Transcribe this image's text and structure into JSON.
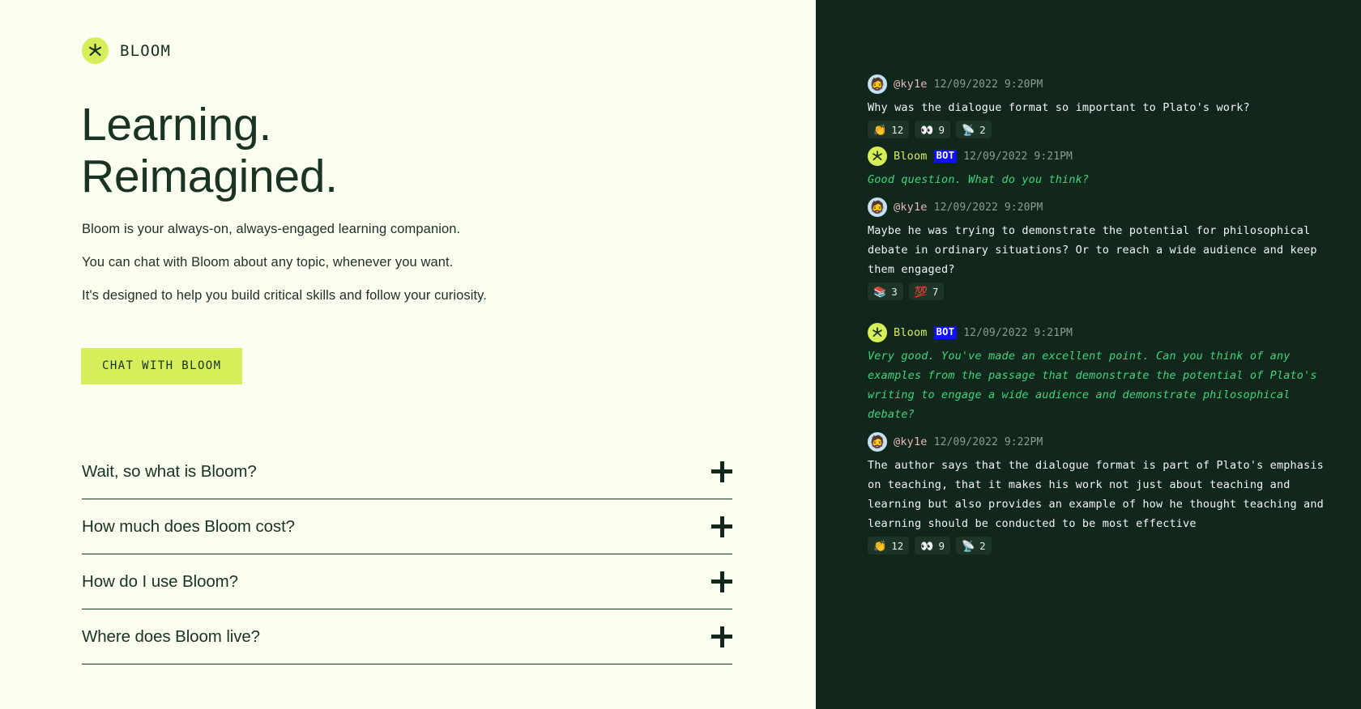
{
  "brand": {
    "name": "BLOOM",
    "logo_icon": "bloom-asterisk-icon",
    "accent_color": "#D7EE5B",
    "dark_color": "#11271C",
    "cream_color": "#FBFFF0"
  },
  "hero": {
    "headline": "Learning.\nReimagined.",
    "paragraphs": [
      "Bloom is your always-on, always-engaged learning companion.",
      "You can chat with Bloom about any topic, whenever you want.",
      "It's designed to help you build critical skills and follow your curiosity."
    ],
    "cta_label": "CHAT WITH BLOOM"
  },
  "faq": {
    "items": [
      {
        "question": "Wait, so what is Bloom?",
        "toggle_icon": "plus-icon"
      },
      {
        "question": "How much does Bloom cost?",
        "toggle_icon": "plus-icon"
      },
      {
        "question": "How do I use Bloom?",
        "toggle_icon": "plus-icon"
      },
      {
        "question": "Where does Bloom live?",
        "toggle_icon": "plus-icon"
      }
    ]
  },
  "chat": {
    "messages": [
      {
        "author": "@ky1e",
        "author_type": "user",
        "avatar_emoji": "🧔",
        "is_bot": false,
        "timestamp": "12/09/2022 9:20PM",
        "text": "Why was the dialogue format so important to Plato's work?",
        "reactions": [
          {
            "emoji": "👏",
            "count": "12"
          },
          {
            "emoji": "👀",
            "count": "9"
          },
          {
            "emoji": "📡",
            "count": "2"
          }
        ]
      },
      {
        "author": "Bloom",
        "author_type": "bot",
        "avatar_emoji": "",
        "is_bot": true,
        "bot_badge": "BOT",
        "timestamp": "12/09/2022 9:21PM",
        "text": "Good question. What do you think?",
        "reactions": []
      },
      {
        "author": "@ky1e",
        "author_type": "user",
        "avatar_emoji": "🧔",
        "is_bot": false,
        "timestamp": "12/09/2022 9:20PM",
        "text": "Maybe he was trying to demonstrate the potential for philosophical debate in ordinary situations? Or to reach a wide audience and keep them engaged?",
        "reactions": [
          {
            "emoji": "📚",
            "count": "3"
          },
          {
            "emoji": "💯",
            "count": "7"
          }
        ]
      },
      {
        "author": "Bloom",
        "author_type": "bot",
        "avatar_emoji": "",
        "is_bot": true,
        "bot_badge": "BOT",
        "timestamp": "12/09/2022 9:21PM",
        "text": "Very good. You've made an excellent point. Can you think of any examples from the passage that demonstrate the potential of Plato's writing to engage a wide audience and demonstrate philosophical debate?",
        "reactions": []
      },
      {
        "author": "@ky1e",
        "author_type": "user",
        "avatar_emoji": "🧔",
        "is_bot": false,
        "timestamp": "12/09/2022 9:22PM",
        "text": "The author says that the dialogue format is part of Plato's emphasis on teaching, that it makes his work not just about teaching and learning but also provides an example of how he thought teaching and learning should be conducted to be most effective",
        "reactions": [
          {
            "emoji": "👏",
            "count": "12"
          },
          {
            "emoji": "👀",
            "count": "9"
          },
          {
            "emoji": "📡",
            "count": "2"
          }
        ]
      }
    ]
  }
}
